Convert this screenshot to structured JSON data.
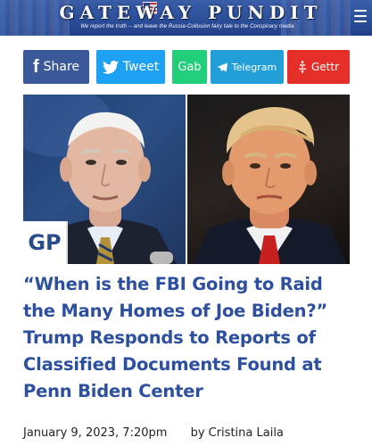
{
  "header": {
    "site_name": "GATEWAY PUNDIT",
    "tagline": "We report the truth -- and leave the Russia-Collusion fairy tale to the Conspiracy media"
  },
  "share": {
    "facebook_label": "Share",
    "twitter_label": "Tweet",
    "gab_label": "Gab",
    "telegram_label": "Telegram",
    "gettr_label": "Gettr"
  },
  "colors": {
    "header_blue": "#2c4f9a",
    "facebook": "#3b5998",
    "twitter": "#1da1f2",
    "gab": "#21cf7b",
    "telegram": "#229ed9",
    "gettr": "#e52e27",
    "headline_blue": "#2c4fa0"
  },
  "image": {
    "badge": "GP"
  },
  "article": {
    "title": "“When is the FBI Going to Raid the Many Homes of Joe Biden?” Trump Responds to Reports of Classified Documents Found at Penn Biden Center",
    "date": "January 9, 2023, 7:20pm",
    "byline": "by Cristina Laila"
  }
}
